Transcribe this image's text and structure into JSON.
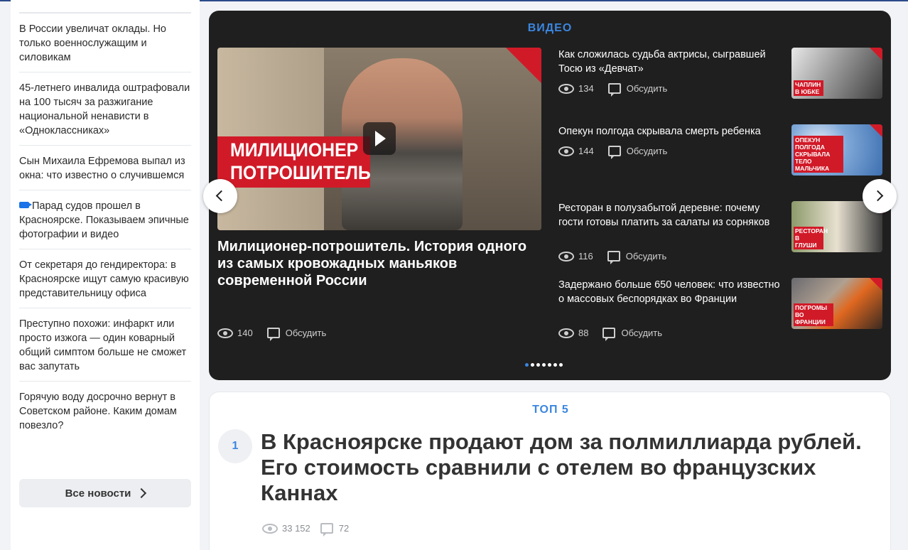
{
  "sidebar": {
    "items": [
      {
        "text": "В России увеличат оклады. Но только военнослужащим и силовикам",
        "video": false
      },
      {
        "text": "45-летнего инвалида оштрафовали на 100 тысяч за разжигание национальной ненависти в «Одноклассниках»",
        "video": false
      },
      {
        "text": "Сын Михаила Ефремова выпал из окна: что известно о случившемся",
        "video": false
      },
      {
        "text": "Парад судов прошел в Красноярске. Показываем эпичные фотографии и видео",
        "video": true
      },
      {
        "text": "От секретаря до гендиректора: в Красноярске ищут самую красивую представительницу офиса",
        "video": false
      },
      {
        "text": "Преступно похожи: инфаркт или просто изжога — один коварный общий симптом больше не сможет вас запутать",
        "video": false
      },
      {
        "text": "Горячую воду досрочно вернут в Советском районе. Каким домам повезло?",
        "video": false
      }
    ],
    "all_news": "Все новости"
  },
  "video": {
    "heading": "ВИДЕО",
    "main": {
      "thumb_caption_1": "МИЛИЦИОНЕР",
      "thumb_caption_2": "ПОТРОШИТЕЛЬ",
      "title": "Милиционер-потрошитель. История одного из самых кровожадных маньяков современной России",
      "views": "140",
      "discuss": "Обсудить"
    },
    "side": [
      {
        "title": "Как сложилась судьба актрисы, сыгравшей Тосю из «Девчат»",
        "views": "134",
        "discuss": "Обсудить",
        "caption": "ЧАПЛИН В ЮБКЕ",
        "thumb_color": "#8d8d8d"
      },
      {
        "title": "Опекун полгода скрывала смерть ребенка",
        "views": "144",
        "discuss": "Обсудить",
        "caption": "ОПЕКУН ПОЛГОДА СКРЫВАЛА ТЕЛО МАЛЬЧИКА",
        "thumb_color": "#4f86c4"
      },
      {
        "title": "Ресторан в полузабытой деревне: почему гости готовы платить за салаты из сорняков",
        "views": "116",
        "discuss": "Обсудить",
        "caption": "РЕСТОРАН В ГЛУШИ",
        "thumb_color": "#6d7a4e"
      },
      {
        "title": "Задержано больше 650 человек: что известно о массовых беспорядках во Франции",
        "views": "88",
        "discuss": "Обсудить",
        "caption": "ПОГРОМЫ ВО ФРАНЦИИ",
        "thumb_color": "#5a4a3c"
      }
    ],
    "dots_total": 7,
    "dots_active": 1
  },
  "top5": {
    "heading": "ТОП 5",
    "rank": "1",
    "title": "В Красноярске продают дом за полмиллиарда рублей. Его стоимость сравнили с отелем во французских Каннах",
    "views": "33 152",
    "comments": "72"
  },
  "colors": {
    "accent": "#3b86e0",
    "video_bg": "#1f1f1f",
    "red": "#d11a28"
  }
}
